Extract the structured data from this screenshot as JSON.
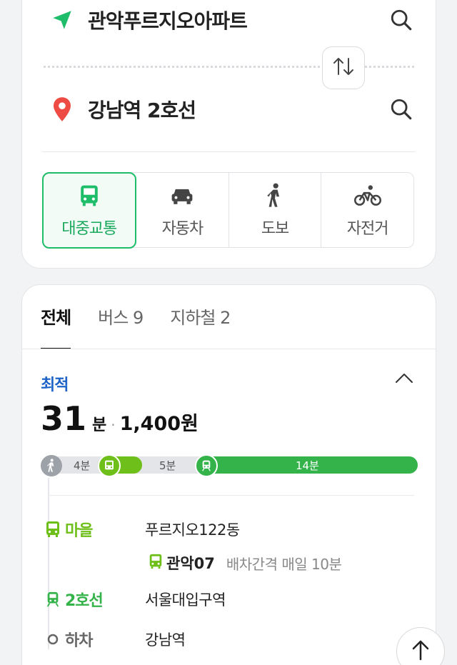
{
  "route": {
    "origin": "관악푸르지오아파트",
    "destination": "강남역 2호선"
  },
  "modes": [
    {
      "label": "대중교통",
      "icon": "bus-icon",
      "active": true
    },
    {
      "label": "자동차",
      "icon": "car-icon",
      "active": false
    },
    {
      "label": "도보",
      "icon": "walk-icon",
      "active": false
    },
    {
      "label": "자전거",
      "icon": "bicycle-icon",
      "active": false
    }
  ],
  "tabs": [
    {
      "label": "전체",
      "active": true
    },
    {
      "label": "버스 9",
      "active": false
    },
    {
      "label": "지하철 2",
      "active": false
    }
  ],
  "result": {
    "badge": "최적",
    "minutes": "31",
    "minutes_unit": "분",
    "separator": "·",
    "fare": "1,400원"
  },
  "timeline": {
    "walk_label": "4분",
    "bus_label": "5분",
    "subway_label": "14분",
    "walk_minutes": 4,
    "bus_minutes": 5,
    "subway_minutes": 14
  },
  "steps": [
    {
      "tag": "마을",
      "icon": "bus-icon",
      "where": "푸르지오122동",
      "color": "#6fbf1a"
    },
    {
      "tag": "2호선",
      "icon": "subway-icon",
      "where": "서울대입구역",
      "color": "#34b34a"
    },
    {
      "tag": "하차",
      "icon": "stop-circle-icon",
      "where": "강남역",
      "color": "#666666"
    }
  ],
  "bus_detail": {
    "number": "관악07",
    "interval": "배차간격 매일 10분"
  },
  "colors": {
    "accent": "#1ebd6a",
    "best": "#1d63c8",
    "village_bus": "#6fbf1a",
    "line2": "#34b34a",
    "origin_pin": "#1ebd6a",
    "dest_pin": "#ef4b45"
  }
}
